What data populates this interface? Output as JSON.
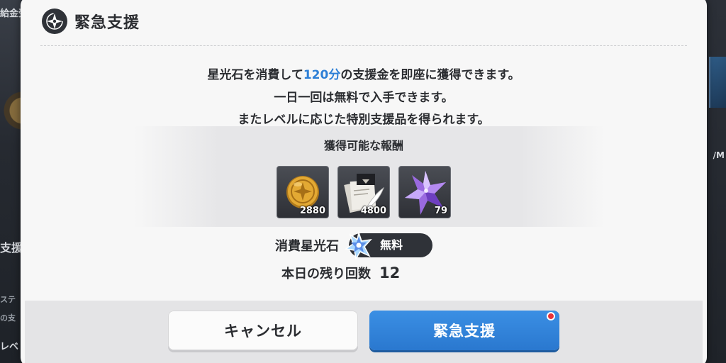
{
  "background": {
    "left_top_text": "給金受",
    "left_mid_text": "支援",
    "left_low_text1": "ステ",
    "left_low_text2": "の支",
    "left_bottom_text": "レベ",
    "right_text": "/M"
  },
  "dialog": {
    "title": "緊急支援",
    "title_icon": "compass-star-icon",
    "description": {
      "line1_pre": "星光石を消費して",
      "line1_highlight": "120分",
      "line1_post": "の支援金を即座に獲得できます。",
      "line2": "一日一回は無料で入手できます。",
      "line3": "またレベルに応じた特別支援品を得られます。"
    },
    "rewards": {
      "title": "獲得可能な報酬",
      "items": [
        {
          "icon": "gold-coin-icon",
          "count": "2880"
        },
        {
          "icon": "documents-quill-icon",
          "count": "4800"
        },
        {
          "icon": "purple-crystal-icon",
          "count": "79"
        }
      ]
    },
    "cost": {
      "label": "消費星光石",
      "icon": "star-stone-icon",
      "value": "無料"
    },
    "remaining": {
      "label": "本日の残り回数",
      "value": "12"
    },
    "buttons": {
      "cancel": "キャンセル",
      "confirm": "緊急支援"
    }
  },
  "colors": {
    "accent_blue": "#2d7fd6",
    "notification_red": "#e8333a"
  }
}
